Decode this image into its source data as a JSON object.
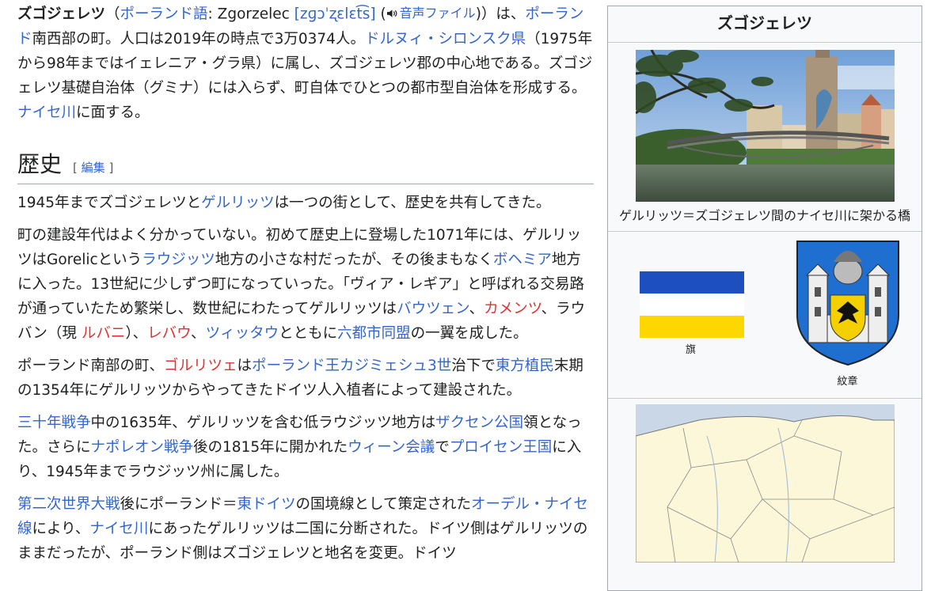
{
  "article": {
    "lead": {
      "title": "ズゴジェレツ",
      "lang_link": "ポーランド語",
      "lang_text": ": Zgorzelec ",
      "ipa": "[zɡɔˈʐɛlɛt͡s]",
      "audio_label": "音声ファイル",
      "t1": ")）は、",
      "poland": "ポーランド",
      "t2": "南西部の町。人口は2019年の時点で3万0374人。",
      "voivodeship": "ドルヌィ・シロンスク県",
      "t3": "（1975年から98年まではイェレニア・グラ県）に属し、ズゴジェレツ郡の中心地である。ズゴジェレツ基礎自治体（グミナ）には入らず、町自体でひとつの都市型自治体を形成する。",
      "neisse": "ナイセ川",
      "t4": "に面する。"
    },
    "history": {
      "heading": "歴史",
      "edit_open": "[",
      "edit_label": "編集",
      "edit_close": "]",
      "p1": {
        "a": "1945年までズゴジェレツと",
        "goerlitz": "ゲルリッツ",
        "b": "は一つの街として、歴史を共有してきた。"
      },
      "p2": {
        "a": "町の建設年代はよく分かっていない。初めて歴史上に登場した1071年には、ゲルリッツはGorelicという",
        "lusatia": "ラウジッツ",
        "b": "地方の小さな村だったが、その後まもなく",
        "bohemia": "ボヘミア",
        "c": "地方に入った。13世紀に少しずつ町になっていった。「ヴィア・レギア」と呼ばれる交易路が通っていたため繁栄し、数世紀にわたってゲルリッツは",
        "bautzen": "バウツェン",
        "d": "、",
        "kamenz": "カメンツ",
        "e": "、ラウバン（現 ",
        "luban": "ルバニ",
        "f": "）、",
        "lobau": "レバウ",
        "g": "、",
        "zittau": "ツィッタウ",
        "h": "とともに",
        "league": "六都市同盟",
        "i": "の一翼を成した。"
      },
      "p3": {
        "a": "ポーランド南部の町、",
        "gorlice": "ゴルリツェ",
        "b": "は",
        "casimir": "ポーランド王カジミェシュ3世",
        "c": "治下で",
        "ostsiedlung": "東方植民",
        "d": "末期の1354年にゲルリッツからやってきたドイツ人入植者によって建設された。"
      },
      "p4": {
        "thirty": "三十年戦争",
        "a": "中の1635年、ゲルリッツを含む低ラウジッツ地方は",
        "saxony": "ザクセン公国",
        "b": "領となった。さらに",
        "napoleonic": "ナポレオン戦争",
        "c": "後の1815年に開かれた",
        "vienna": "ウィーン会議",
        "d": "で",
        "prussia": "プロイセン王国",
        "e": "に入り、1945年までラウジッツ州に属した。"
      },
      "p5": {
        "ww2": "第二次世界大戦",
        "a": "後にポーランド＝",
        "eastgermany": "東ドイツ",
        "b": "の国境線として策定された",
        "odernEisse": "オーデル・ナイセ線",
        "c": "により、",
        "neisse": "ナイセ川",
        "d": "にあったゲルリッツは二国に分断された。ドイツ側はゲルリッツのままだったが、ポーランド側はズゴジェレツと地名を変更。ドイツ"
      }
    }
  },
  "infobox": {
    "title": "ズゴジェレツ",
    "photo_caption": "ゲルリッツ＝ズゴジェレツ間のナイセ川に架かる橋",
    "flag_label": "旗",
    "coat_label": "紋章",
    "flag_colors": [
      "#1e4fbf",
      "#ffffff",
      "#ffd700"
    ]
  }
}
